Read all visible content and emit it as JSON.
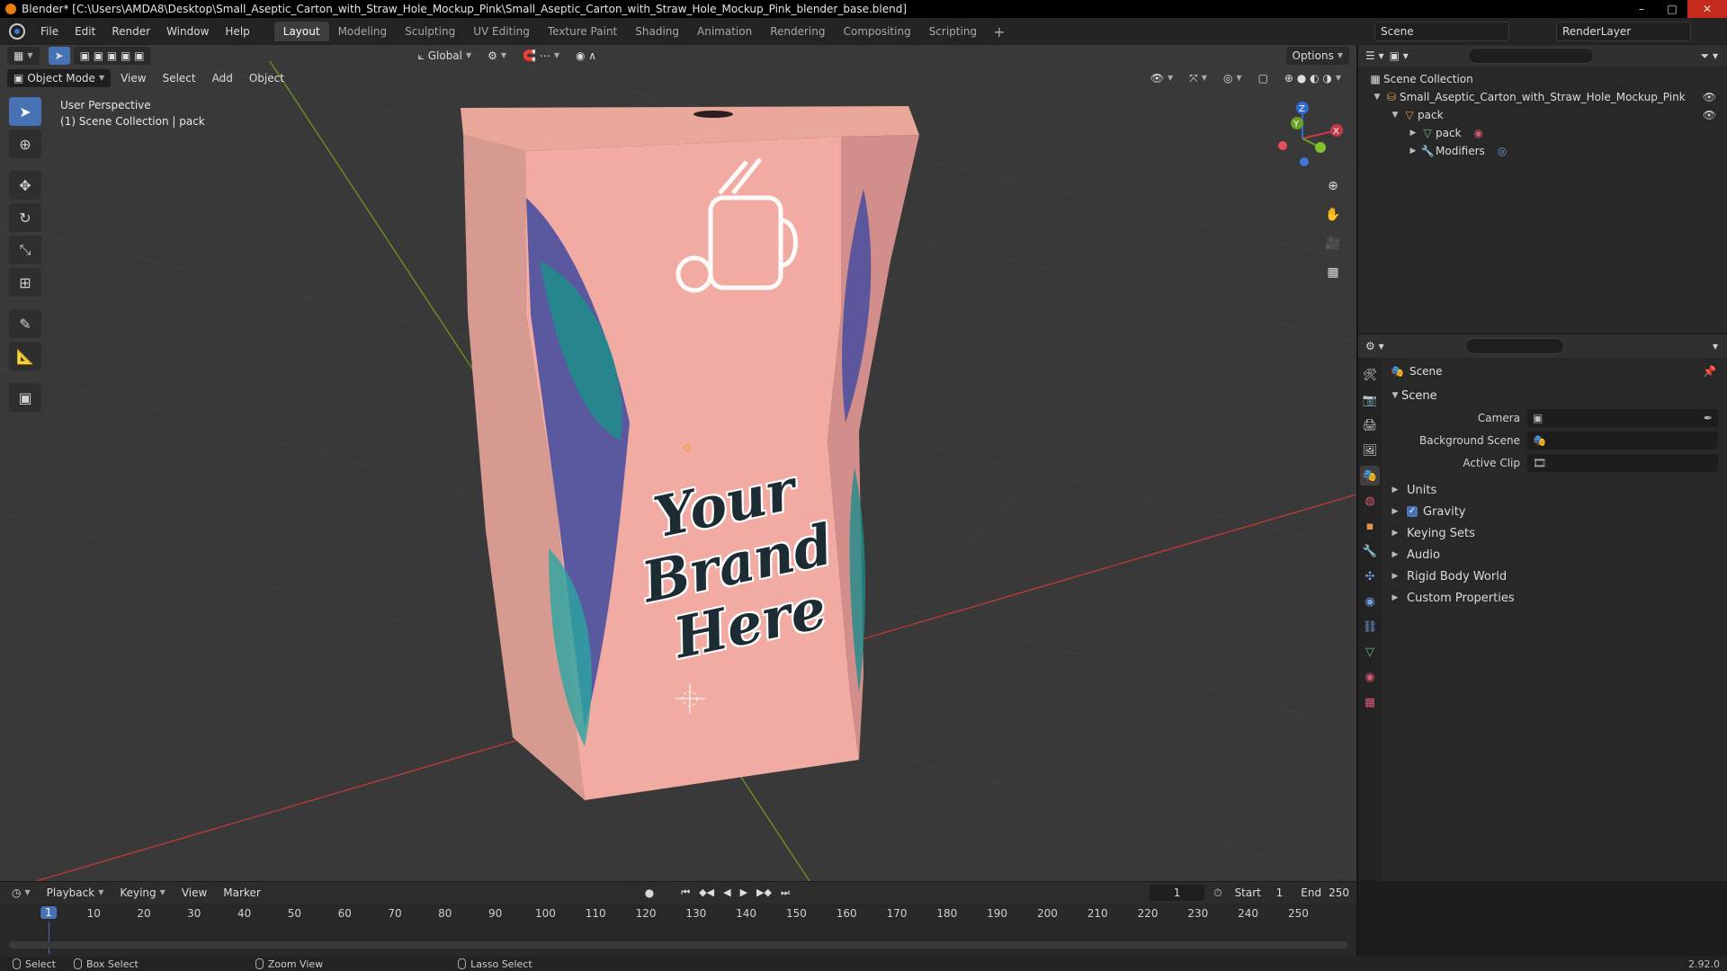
{
  "window": {
    "title": "Blender* [C:\\Users\\AMDA8\\Desktop\\Small_Aseptic_Carton_with_Straw_Hole_Mockup_Pink\\Small_Aseptic_Carton_with_Straw_Hole_Mockup_Pink_blender_base.blend]",
    "minimize": "–",
    "maximize": "□",
    "close": "✕"
  },
  "menu": [
    "File",
    "Edit",
    "Render",
    "Window",
    "Help"
  ],
  "workspaces": [
    "Layout",
    "Modeling",
    "Sculpting",
    "UV Editing",
    "Texture Paint",
    "Shading",
    "Animation",
    "Rendering",
    "Compositing",
    "Scripting"
  ],
  "workspace_add": "+",
  "scene_name": "Scene",
  "view_layer": "RenderLayer",
  "viewport": {
    "mode": "Object Mode",
    "menus": [
      "View",
      "Select",
      "Add",
      "Object"
    ],
    "orientation": "Global",
    "options": "Options",
    "overlay_line1": "User Perspective",
    "overlay_line2": "(1) Scene Collection | pack",
    "background_color": "#393939",
    "grid_x_color": "#b53a3a",
    "grid_y_color": "#6b8f23"
  },
  "carton": {
    "brand_line1": "Your",
    "brand_line2": "Brand",
    "brand_line3": "Here",
    "color": "#f2b6a7"
  },
  "gizmo": {
    "x": "X",
    "y": "Y",
    "z": "Z"
  },
  "outliner": {
    "root": "Scene Collection",
    "collection": "Small_Aseptic_Carton_with_Straw_Hole_Mockup_Pink",
    "object": "pack",
    "mesh": "pack",
    "modifiers": "Modifiers"
  },
  "properties": {
    "title": "Scene",
    "panel": "Scene",
    "camera_label": "Camera",
    "background_scene_label": "Background Scene",
    "active_clip_label": "Active Clip",
    "subpanels": [
      "Units",
      "Gravity",
      "Keying Sets",
      "Audio",
      "Rigid Body World",
      "Custom Properties"
    ],
    "gravity_checked": true
  },
  "timeline": {
    "menus": [
      "Playback",
      "Keying",
      "View",
      "Marker"
    ],
    "current_frame": "1",
    "start_label": "Start",
    "start_value": "1",
    "end_label": "End",
    "end_value": "250",
    "ruler": [
      "1",
      "10",
      "20",
      "30",
      "40",
      "50",
      "60",
      "70",
      "80",
      "90",
      "100",
      "110",
      "120",
      "130",
      "140",
      "150",
      "160",
      "170",
      "180",
      "190",
      "200",
      "210",
      "220",
      "230",
      "240",
      "250"
    ]
  },
  "statusbar": {
    "select": "Select",
    "box_select": "Box Select",
    "zoom_view": "Zoom View",
    "lasso_select": "Lasso Select",
    "version": "2.92.0"
  }
}
